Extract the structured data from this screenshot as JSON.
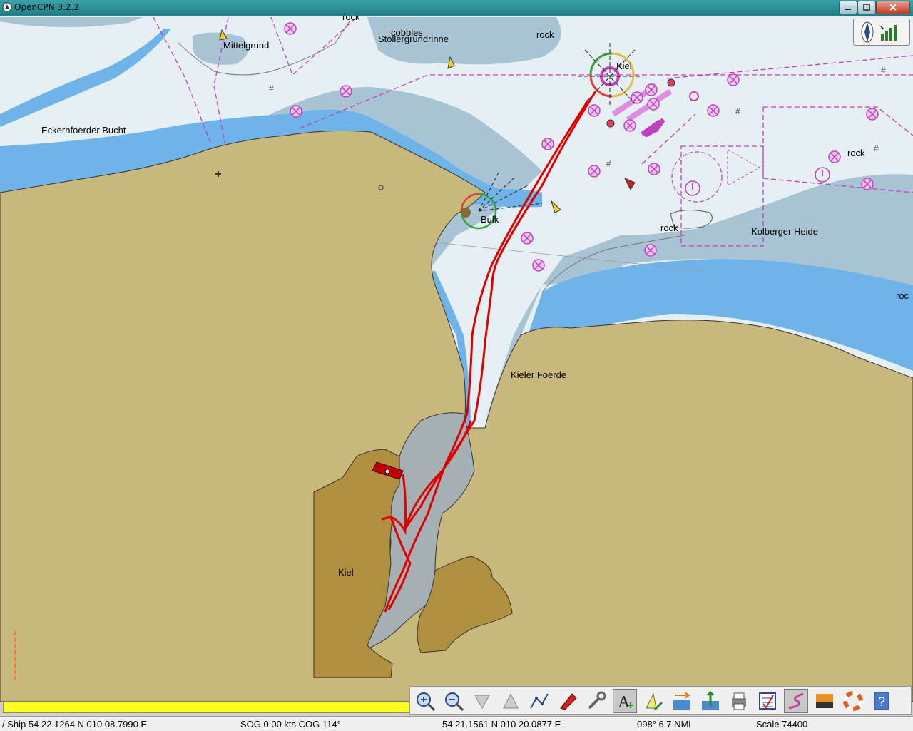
{
  "window": {
    "title": "OpenCPN 3.2.2"
  },
  "chart": {
    "labels": {
      "rock_top": "rock",
      "cobbles": "cobbles",
      "stollergrund": "Stollergrundrinne",
      "rock_n": "rock",
      "mittelgrund": "Mittelgrund",
      "eckernfoerde": "Eckernfoerder Bucht",
      "kiel_light": "Kiel",
      "rock_e": "rock",
      "rock_mid": "rock",
      "kolberger": "Kolberger Heide",
      "rock_right": "roc",
      "bulk": "Bulk",
      "kieler_foerde": "Kieler Foerde",
      "kiel_city": "Kiel"
    },
    "colors": {
      "land": "#c8b87c",
      "town": "#b0903e",
      "deep": "#e6f0f4",
      "shallow": "#a8c4d4",
      "blue": "#6eb4e8",
      "harbor": "#a4b0b4",
      "magenta": "#c040c0",
      "track": "#e00000"
    }
  },
  "toolbar": {
    "buttons": [
      "zoom-in",
      "zoom-out",
      "chart-quilt-down",
      "chart-quilt-up",
      "route",
      "ship",
      "settings",
      "text",
      "ais",
      "current",
      "tide",
      "print",
      "route-manager",
      "track",
      "colour-scheme",
      "mob",
      "help"
    ],
    "active": [
      "text",
      "track"
    ]
  },
  "status": {
    "ship": "/ Ship 54 22.1264 N   010 08.7990 E",
    "sog": "SOG 0.00 kts  COG 114°",
    "cursor": "54 21.1561 N   010 20.0877 E",
    "brg": "098°   6.7 NMi",
    "scale": "Scale 74400"
  }
}
